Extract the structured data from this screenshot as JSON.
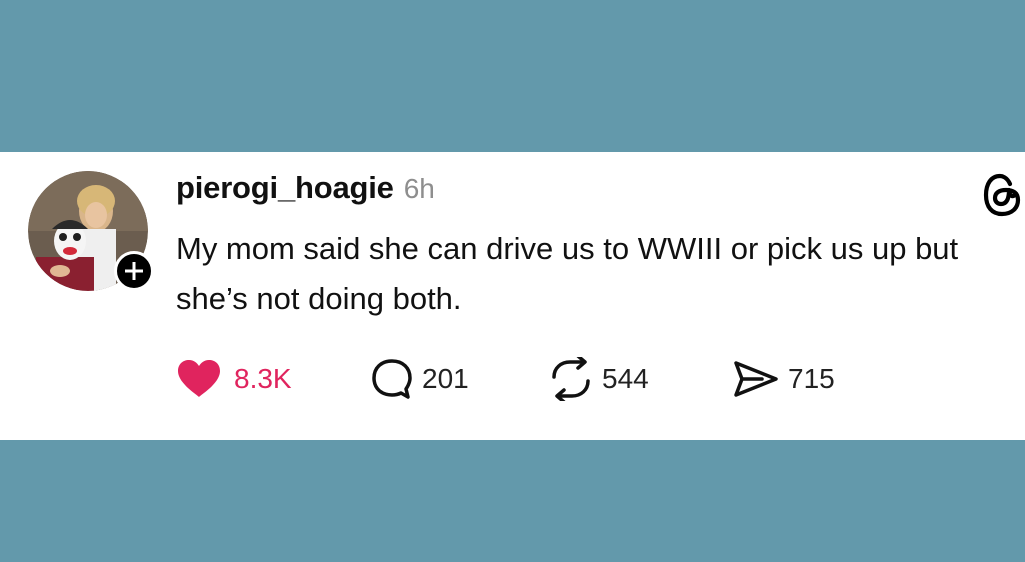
{
  "post": {
    "username": "pierogi_hoagie",
    "time": "6h",
    "text": "My mom said she can drive us to WWIII or pick us up but she’s not doing both."
  },
  "actions": {
    "likes": "8.3K",
    "replies": "201",
    "reposts": "544",
    "shares": "715"
  },
  "icons": {
    "avatar": "profile-avatar",
    "follow": "plus-icon",
    "logo": "threads-logo-icon",
    "like": "heart-icon",
    "reply": "speech-bubble-icon",
    "repost": "repost-icon",
    "share": "paper-plane-icon"
  },
  "colors": {
    "background": "#6399ab",
    "card": "#ffffff",
    "like": "#e0245e",
    "text": "#111111",
    "muted": "#8e8e8e"
  }
}
